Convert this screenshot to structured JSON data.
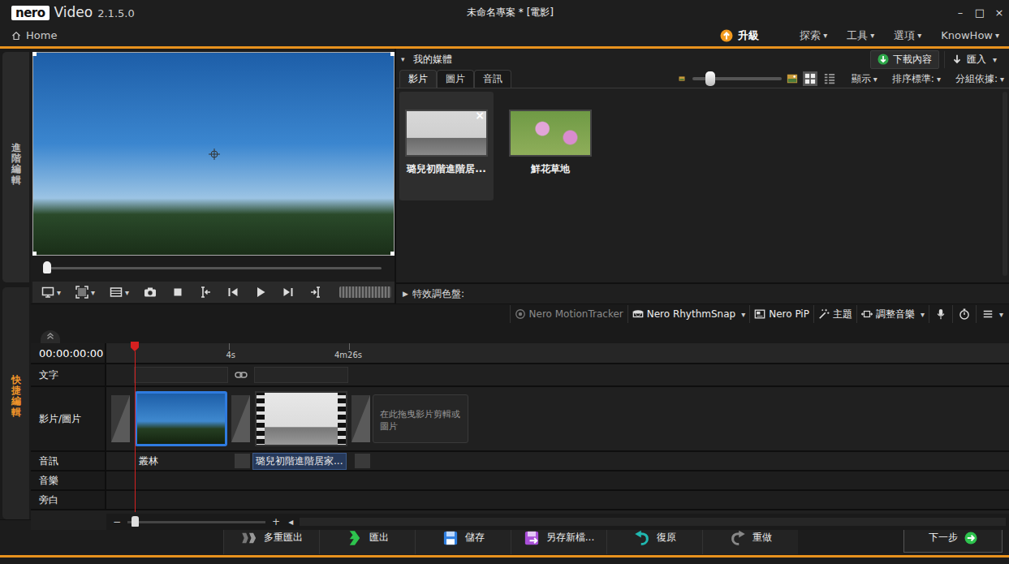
{
  "window": {
    "logo": "nero",
    "app": "Video",
    "version": "2.1.5.0",
    "title": "未命名專案 * [電影]",
    "controls": [
      "–",
      "□",
      "×"
    ]
  },
  "nav": {
    "home": "Home",
    "upgrade": "升級",
    "menus": [
      "探索",
      "工具",
      "選項",
      "KnowHow"
    ]
  },
  "glyphs": {
    "dropdown": "▾",
    "expanded": "▾",
    "collapsed": "▶",
    "minus": "−",
    "plus": "+",
    "close": "×",
    "scroll_left": "◂"
  },
  "side_tabs": [
    {
      "label": "進階編輯",
      "selected": false
    },
    {
      "label": "快捷編輯",
      "selected": true
    }
  ],
  "preview": {
    "position": 0
  },
  "media": {
    "title": "我的媒體",
    "download": "下載內容",
    "import": "匯入",
    "tabs": [
      {
        "label": "影片",
        "selected": true
      },
      {
        "label": "圖片",
        "selected": false
      },
      {
        "label": "音訊",
        "selected": false
      }
    ],
    "zoom": 0.2,
    "view_options": [
      "顯示",
      "排序標準:",
      "分組依據:"
    ],
    "items": [
      {
        "label": "璐兒初階進階居...",
        "selected": true
      },
      {
        "label": "鮮花草地",
        "selected": false
      }
    ],
    "effects": "特效調色盤:"
  },
  "tools": [
    {
      "label": "Nero MotionTracker",
      "kind": "motion-tracker",
      "disabled": true,
      "dropdown": false
    },
    {
      "label": "Nero RhythmSnap",
      "kind": "rhythm-snap",
      "disabled": false,
      "dropdown": true
    },
    {
      "label": "Nero PiP",
      "kind": "pip",
      "disabled": false,
      "dropdown": false
    },
    {
      "label": "主題",
      "kind": "theme",
      "disabled": false,
      "dropdown": false
    },
    {
      "label": "調整音樂",
      "kind": "adjust-music",
      "disabled": false,
      "dropdown": true
    }
  ],
  "timeline": {
    "time": "00:00:00:00",
    "ruler": [
      "4s",
      "4m26s"
    ],
    "tracks": [
      "文字",
      "影片/圖片",
      "音訊",
      "音樂",
      "旁白"
    ],
    "clips": [
      {
        "label": "叢林",
        "kind": "image",
        "selected": true
      },
      {
        "label": "璐兒初階進階居家...",
        "kind": "video",
        "selected": false
      }
    ],
    "placeholder": "在此拖曳影片剪輯或圖片",
    "zoom": 0.05
  },
  "actions": [
    {
      "label": "多重匯出",
      "kind": "multi-export",
      "disabled": true
    },
    {
      "label": "匯出",
      "kind": "export",
      "disabled": false
    },
    {
      "label": "儲存",
      "kind": "save",
      "disabled": false
    },
    {
      "label": "另存新檔...",
      "kind": "save-as",
      "disabled": false
    },
    {
      "label": "復原",
      "kind": "undo",
      "disabled": false
    },
    {
      "label": "重做",
      "kind": "redo",
      "disabled": false
    }
  ],
  "next": "下一步"
}
